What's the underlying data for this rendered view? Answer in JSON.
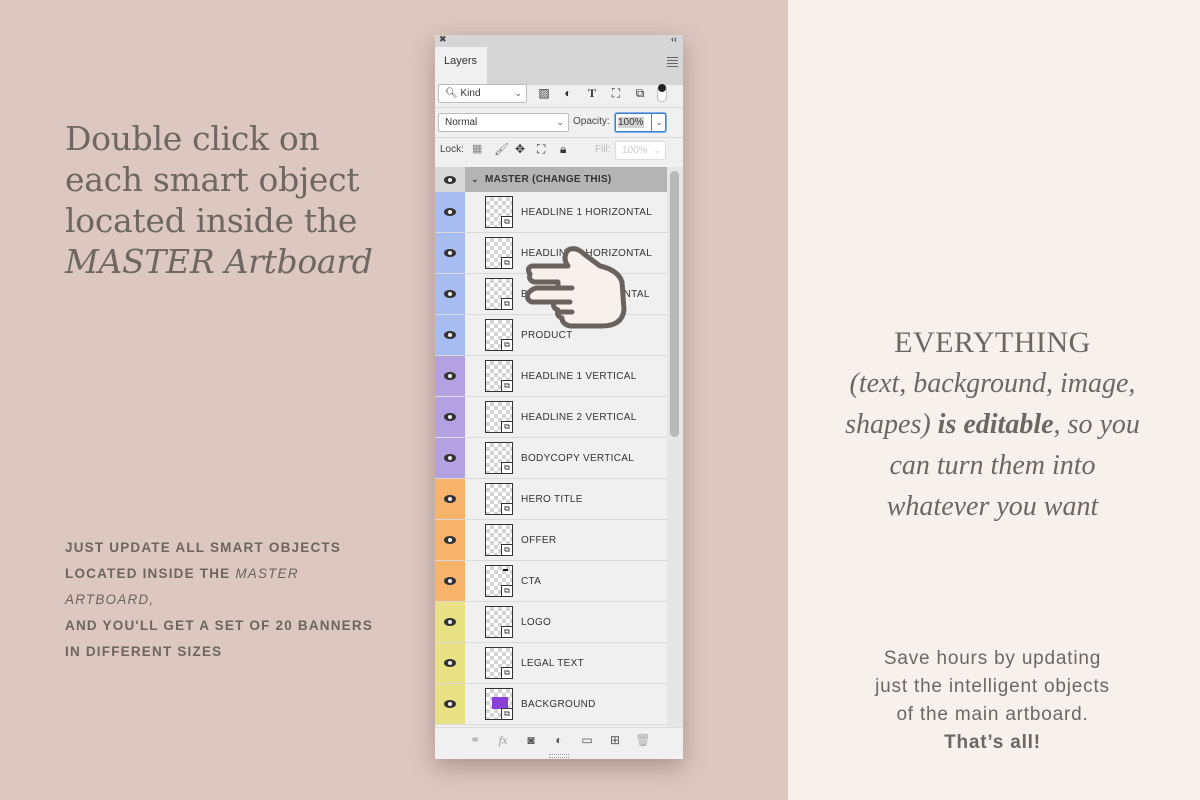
{
  "left": {
    "headline_parts": [
      "Double click on each smart object located inside the ",
      "MASTER Artboard"
    ],
    "caps_note": {
      "line1": "JUST UPDATE ALL SMART OBJECTS",
      "line2_prefix": "LOCATED INSIDE THE ",
      "line2_italic": "MASTER ARTBOARD,",
      "line3": "AND YOU'LL GET A SET OF 20 BANNERS",
      "line4": "IN DIFFERENT SIZES"
    }
  },
  "right": {
    "everything": {
      "title": "EVERYTHING",
      "line_a": "(text, background, image,",
      "line_b_prefix": "shapes) ",
      "line_b_bold": "is editable",
      "line_b_suffix": ", so you",
      "line_c": "can turn them into",
      "line_d": "whatever you want"
    },
    "save_note": {
      "line1": "Save hours by updating",
      "line2": "just the intelligent objects",
      "line3": "of the main artboard.",
      "bold": "That’s all!"
    }
  },
  "panel": {
    "close_glyph": "✖",
    "collapse_glyph": "‹‹",
    "tab_label": "Layers",
    "filter_kind": "Kind",
    "blend_mode": "Normal",
    "opacity_label": "Opacity:",
    "opacity_value": "100%",
    "lock_label": "Lock:",
    "fill_label": "Fill:",
    "fill_value": "100%",
    "group": {
      "name": "MASTER (CHANGE THIS)"
    },
    "layers": [
      {
        "name": "HEADLINE 1 HORIZONTAL",
        "color": "#a7bdf2"
      },
      {
        "name": "HEADLINE 2 HORIZONTAL",
        "color": "#a7bdf2"
      },
      {
        "name": "BODYCOPY HORIZONTAL",
        "color": "#a7bdf2"
      },
      {
        "name": "PRODUCT",
        "color": "#a7bdf2"
      },
      {
        "name": "HEADLINE 1 VERTICAL",
        "color": "#b3a1e2"
      },
      {
        "name": "HEADLINE 2 VERTICAL",
        "color": "#b3a1e2"
      },
      {
        "name": "BODYCOPY VERTICAL",
        "color": "#b3a1e2"
      },
      {
        "name": "HERO TITLE",
        "color": "#f7b36a"
      },
      {
        "name": "OFFER",
        "color": "#f7b36a"
      },
      {
        "name": "CTA",
        "color": "#f7b36a"
      },
      {
        "name": "LOGO",
        "color": "#e9e285"
      },
      {
        "name": "LEGAL TEXT",
        "color": "#e9e285"
      },
      {
        "name": "BACKGROUND",
        "color": "#e9e285"
      }
    ]
  }
}
